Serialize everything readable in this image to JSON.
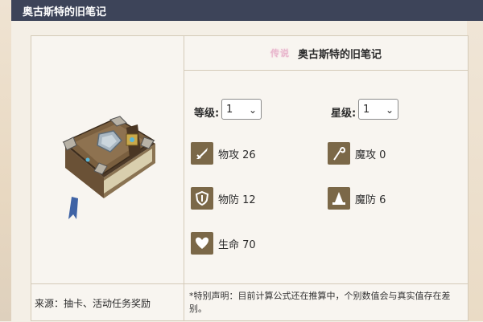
{
  "header": {
    "title": "奥古斯特的旧笔记"
  },
  "item": {
    "rarity_label": "传说",
    "name": "奥古斯特的旧笔记",
    "icon": "old-notebook-book-icon"
  },
  "selects": {
    "level": {
      "label": "等级:",
      "value": "1"
    },
    "star": {
      "label": "星级:",
      "value": "1"
    }
  },
  "stats": [
    {
      "icon": "sword-icon",
      "label": "物攻 26"
    },
    {
      "icon": "magic-staff-icon",
      "label": "魔攻 0"
    },
    {
      "icon": "shield-icon",
      "label": "物防 12"
    },
    {
      "icon": "wizard-hat-icon",
      "label": "魔防 6"
    },
    {
      "icon": "heart-icon",
      "label": "生命 70"
    }
  ],
  "footer": {
    "source": "来源：抽卡、活动任务奖励",
    "note": "*特别声明：目前计算公式还在推算中，个别数值会与真实值存在差别。"
  },
  "colors": {
    "header_bg": "#3d4459",
    "icon_bg": "#7b6848",
    "rarity": "#e8b7cc"
  }
}
